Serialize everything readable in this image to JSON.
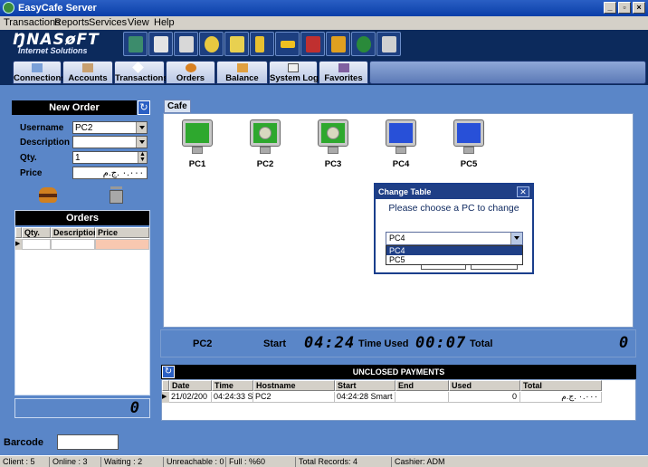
{
  "window": {
    "title": "EasyCafe Server"
  },
  "menu": {
    "items": [
      "Transactions",
      "Reports",
      "Services",
      "View",
      "Help"
    ]
  },
  "logo": {
    "line1": "ŊNASøFT",
    "line2": "Internet Solutions"
  },
  "toolbar_icons": [
    "clients-icon",
    "document-icon",
    "report-icon",
    "settings-icon",
    "calculator-icon",
    "keys-icon",
    "key-icon",
    "door-icon",
    "book-icon",
    "globe-icon",
    "tag-icon"
  ],
  "tabs": [
    "Connections",
    "Accounts",
    "Transactions",
    "Orders",
    "Balance",
    "System Log",
    "Favorites"
  ],
  "new_order": {
    "title": "New Order",
    "username_label": "Username",
    "username_value": "PC2",
    "description_label": "Description",
    "description_value": "",
    "qty_label": "Qty.",
    "qty_value": "1",
    "price_label": "Price",
    "price_value": "٠.٠٠٠ .ج.م"
  },
  "orders": {
    "title": "Orders",
    "columns": [
      "Qty.",
      "Description",
      "Price"
    ],
    "total": "0"
  },
  "cafe": {
    "tab": "Cafe",
    "pcs": [
      {
        "name": "PC1",
        "state": "green"
      },
      {
        "name": "PC2",
        "state": "inuse"
      },
      {
        "name": "PC3",
        "state": "inuse"
      },
      {
        "name": "PC4",
        "state": "blue"
      },
      {
        "name": "PC5",
        "state": "blue"
      }
    ]
  },
  "dialog": {
    "title": "Change Table",
    "prompt": "Please choose a PC to change",
    "selected": "PC4",
    "options": [
      "PC4",
      "PC5"
    ]
  },
  "session": {
    "pc": "PC2",
    "start_label": "Start",
    "start_value": "04:24",
    "time_used_label": "Time Used",
    "time_used_value": "00:07",
    "total_label": "Total",
    "total_value": "0"
  },
  "payments": {
    "title": "UNCLOSED PAYMENTS",
    "columns": [
      "Date",
      "Time",
      "Hostname",
      "Start",
      "End",
      "Used",
      "Total"
    ],
    "rows": [
      [
        "21/02/200",
        "04:24:33 S",
        "PC2",
        "04:24:28 Smart S",
        "",
        "0",
        "٠.٠٠٠ .ج.م"
      ]
    ]
  },
  "barcode": {
    "label": "Barcode",
    "value": ""
  },
  "status": {
    "client": "Client : 5",
    "online": "Online : 3",
    "waiting": "Waiting : 2",
    "unreachable": "Unreachable : 0",
    "full": "Full : %60",
    "records": "Total Records: 4",
    "cashier": "Cashier: ADM"
  },
  "colors": {
    "background": "#5a86c8",
    "titlebar": "#0a3ea8",
    "pc_green": "#2ea82e",
    "pc_blue": "#2850d8",
    "selection": "#1f3f86"
  }
}
